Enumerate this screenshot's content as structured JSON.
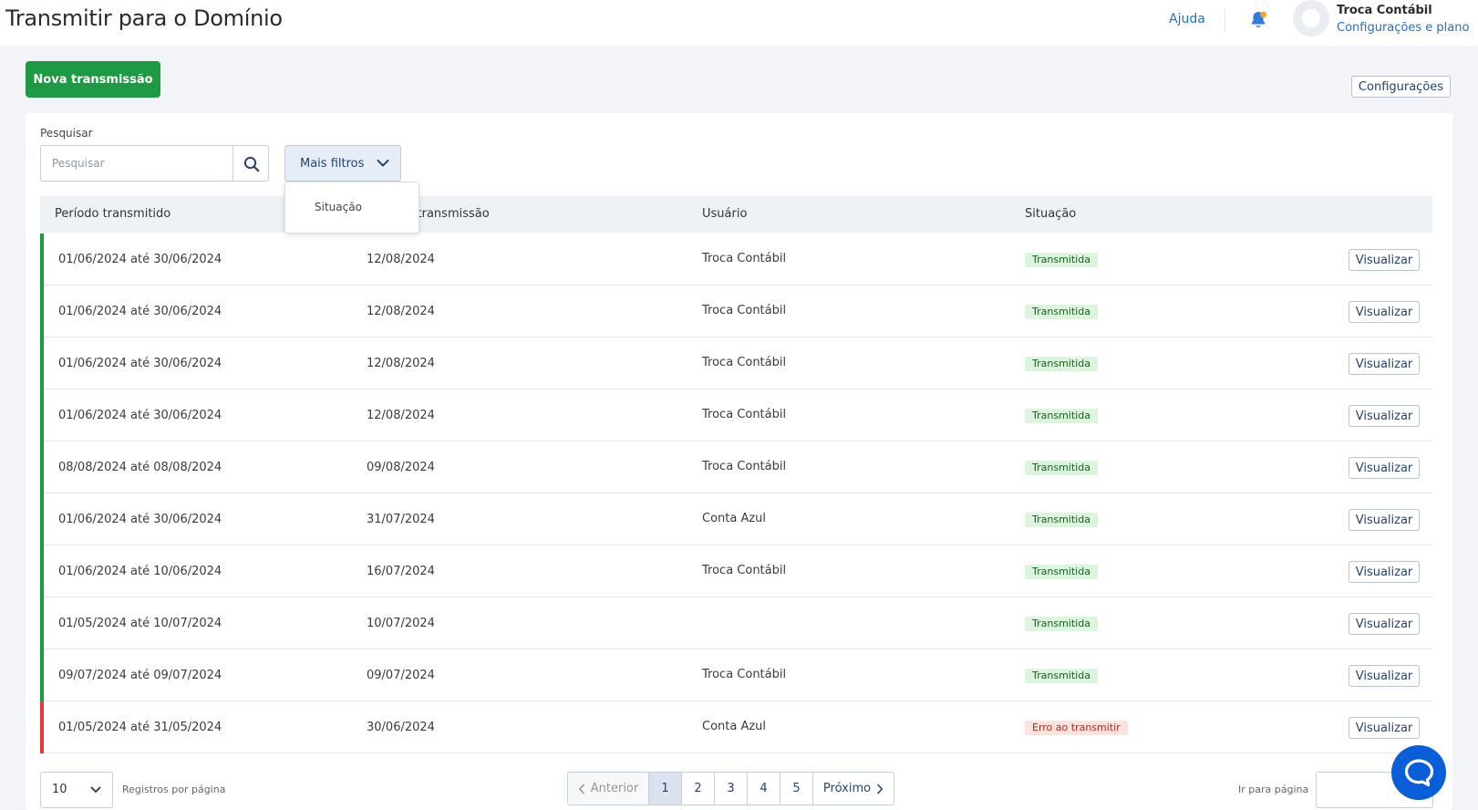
{
  "header": {
    "title": "Transmitir para o Domínio",
    "help_label": "Ajuda",
    "account_name": "Troca Contábil",
    "account_link": "Configurações e plano"
  },
  "toolbar": {
    "new_label": "Nova transmissão",
    "config_label": "Configurações"
  },
  "search": {
    "label": "Pesquisar",
    "placeholder": "Pesquisar",
    "filters_label": "Mais filtros"
  },
  "filters_menu": {
    "items": [
      "Situação"
    ]
  },
  "table": {
    "columns": [
      "Período transmitido",
      "Data da transmissão",
      "Usuário",
      "Situação"
    ],
    "action_label": "Visualizar",
    "rows": [
      {
        "period": "01/06/2024 até 30/06/2024",
        "date": "12/08/2024",
        "user": "Troca Contábil",
        "status": "Transmitida",
        "status_type": "ok"
      },
      {
        "period": "01/06/2024 até 30/06/2024",
        "date": "12/08/2024",
        "user": "Troca Contábil",
        "status": "Transmitida",
        "status_type": "ok"
      },
      {
        "period": "01/06/2024 até 30/06/2024",
        "date": "12/08/2024",
        "user": "Troca Contábil",
        "status": "Transmitida",
        "status_type": "ok"
      },
      {
        "period": "01/06/2024 até 30/06/2024",
        "date": "12/08/2024",
        "user": "Troca Contábil",
        "status": "Transmitida",
        "status_type": "ok"
      },
      {
        "period": "08/08/2024 até 08/08/2024",
        "date": "09/08/2024",
        "user": "Troca Contábil",
        "status": "Transmitida",
        "status_type": "ok"
      },
      {
        "period": "01/06/2024 até 30/06/2024",
        "date": "31/07/2024",
        "user": "Conta Azul",
        "status": "Transmitida",
        "status_type": "ok"
      },
      {
        "period": "01/06/2024 até 10/06/2024",
        "date": "16/07/2024",
        "user": "Troca Contábil",
        "status": "Transmitida",
        "status_type": "ok"
      },
      {
        "period": "01/05/2024 até 10/07/2024",
        "date": "10/07/2024",
        "user": "",
        "status": "Transmitida",
        "status_type": "ok"
      },
      {
        "period": "09/07/2024 até 09/07/2024",
        "date": "09/07/2024",
        "user": "Troca Contábil",
        "status": "Transmitida",
        "status_type": "ok"
      },
      {
        "period": "01/05/2024 até 31/05/2024",
        "date": "30/06/2024",
        "user": "Conta Azul",
        "status": "Erro ao transmitir",
        "status_type": "error"
      }
    ]
  },
  "pagination": {
    "page_size": "10",
    "page_size_label": "Registros por página",
    "prev_label": "Anterior",
    "next_label": "Próximo",
    "pages": [
      "1",
      "2",
      "3",
      "4",
      "5"
    ],
    "current": "1",
    "goto_label": "Ir para página"
  },
  "colors": {
    "primary_green": "#1e9a45",
    "link_blue": "#1d6fd6",
    "success_accent": "#1e9a45",
    "error_accent": "#e53935",
    "chat_blue": "#0a5ed7"
  },
  "icons": {
    "bell": "bell-icon",
    "search": "search-icon",
    "filters_chevron": "chevron-down-icon",
    "pager_prev": "chevron-left-icon",
    "pager_next": "chevron-right-icon",
    "chat": "chat-bubble-icon"
  }
}
